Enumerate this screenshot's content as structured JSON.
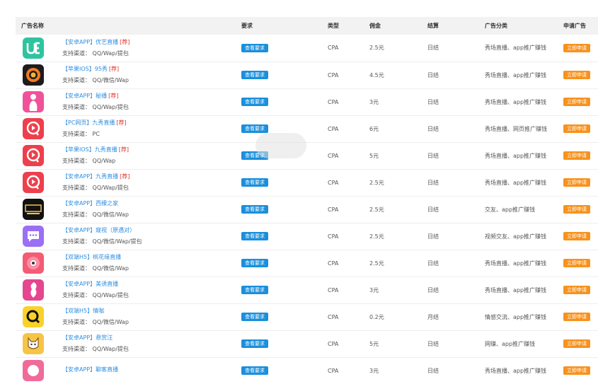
{
  "table": {
    "headers": [
      "广告名称",
      "要求",
      "类型",
      "佣金",
      "结算",
      "广告分类",
      "申请广告"
    ],
    "require_label": "查看要求",
    "apply_label": "立即申请",
    "rows": [
      {
        "platform": "【安卓APP】",
        "name": "优艺直播",
        "tag": "[荐]",
        "channels": "支持渠道：  QQ/Wap/提包",
        "icon": "ue-logo-icon",
        "type": "CPA",
        "commission": "2.5元",
        "settle": "日结",
        "category": "秀场直播、app推广赚钱"
      },
      {
        "platform": "【苹果IOS】",
        "name": "95秀",
        "tag": "[荐]",
        "channels": "支持渠道：  QQ/微信/Wap",
        "icon": "95xiu-logo-icon",
        "type": "CPA",
        "commission": "4.5元",
        "settle": "日结",
        "category": "秀场直播、app推广赚钱"
      },
      {
        "platform": "【安卓APP】",
        "name": "秘播",
        "tag": "[荐]",
        "channels": "支持渠道：  QQ/Wap/提包",
        "icon": "mibo-logo-icon",
        "type": "CPA",
        "commission": "3元",
        "settle": "日结",
        "category": "秀场直播、app推广赚钱"
      },
      {
        "platform": "【PC网页】",
        "name": "九秀直播",
        "tag": "[荐]",
        "channels": "支持渠道：  PC",
        "icon": "jiuxiu-logo-icon",
        "type": "CPA",
        "commission": "6元",
        "settle": "日结",
        "category": "秀场直播、网页推广赚钱"
      },
      {
        "platform": "【苹果IOS】",
        "name": "九秀直播",
        "tag": "[荐]",
        "channels": "支持渠道：  QQ/Wap",
        "icon": "jiuxiu-logo-icon",
        "type": "CPA",
        "commission": "5元",
        "settle": "日结",
        "category": "秀场直播、app推广赚钱"
      },
      {
        "platform": "【安卓APP】",
        "name": "九秀直播",
        "tag": "[荐]",
        "channels": "支持渠道：  QQ/Wap/提包",
        "icon": "jiuxiu-logo-icon",
        "type": "CPA",
        "commission": "2.5元",
        "settle": "日结",
        "category": "秀场直播、app推广赚钱"
      },
      {
        "platform": "【安卓APP】",
        "name": "西檬之家",
        "tag": "",
        "channels": "支持渠道：  QQ/微信/Wap",
        "icon": "ximeng-logo-icon",
        "type": "CPA",
        "commission": "2.5元",
        "settle": "日结",
        "category": "交友、app推广赚钱"
      },
      {
        "platform": "【安卓APP】",
        "name": "窥视（原遇对）",
        "tag": "",
        "channels": "支持渠道：  QQ/微信/Wap/提包",
        "icon": "chat-bubble-logo-icon",
        "type": "CPA",
        "commission": "2.5元",
        "settle": "日结",
        "category": "视频交友、app推广赚钱"
      },
      {
        "platform": "【双端H5】",
        "name": "桃花缘直播",
        "tag": "",
        "channels": "支持渠道：  QQ/微信/Wap",
        "icon": "taohua-logo-icon",
        "type": "CPA",
        "commission": "2.5元",
        "settle": "日结",
        "category": "秀场直播、app推广赚钱"
      },
      {
        "platform": "【安卓APP】",
        "name": "美诱直播",
        "tag": "",
        "channels": "支持渠道：  QQ/Wap/提包",
        "icon": "meiyou-logo-icon",
        "type": "CPA",
        "commission": "3元",
        "settle": "日结",
        "category": "秀场直播、app推广赚钱"
      },
      {
        "platform": "【双端H5】",
        "name": "情咖",
        "tag": "",
        "channels": "支持渠道：  QQ/微信/Wap",
        "icon": "qingka-logo-icon",
        "type": "CPA",
        "commission": "0.2元",
        "settle": "月结",
        "category": "情感交流、app推广赚钱"
      },
      {
        "platform": "【安卓APP】",
        "name": "悬赏汪",
        "tag": "",
        "channels": "支持渠道：  QQ/Wap/提包",
        "icon": "dog-logo-icon",
        "type": "CPA",
        "commission": "5元",
        "settle": "日结",
        "category": "网赚、app推广赚钱"
      },
      {
        "platform": "【安卓APP】",
        "name": "聊客直播",
        "tag": "",
        "channels": "",
        "icon": "liaoke-logo-icon",
        "type": "CPA",
        "commission": "3元",
        "settle": "日结",
        "category": "秀场直播、app推广赚钱"
      }
    ]
  }
}
